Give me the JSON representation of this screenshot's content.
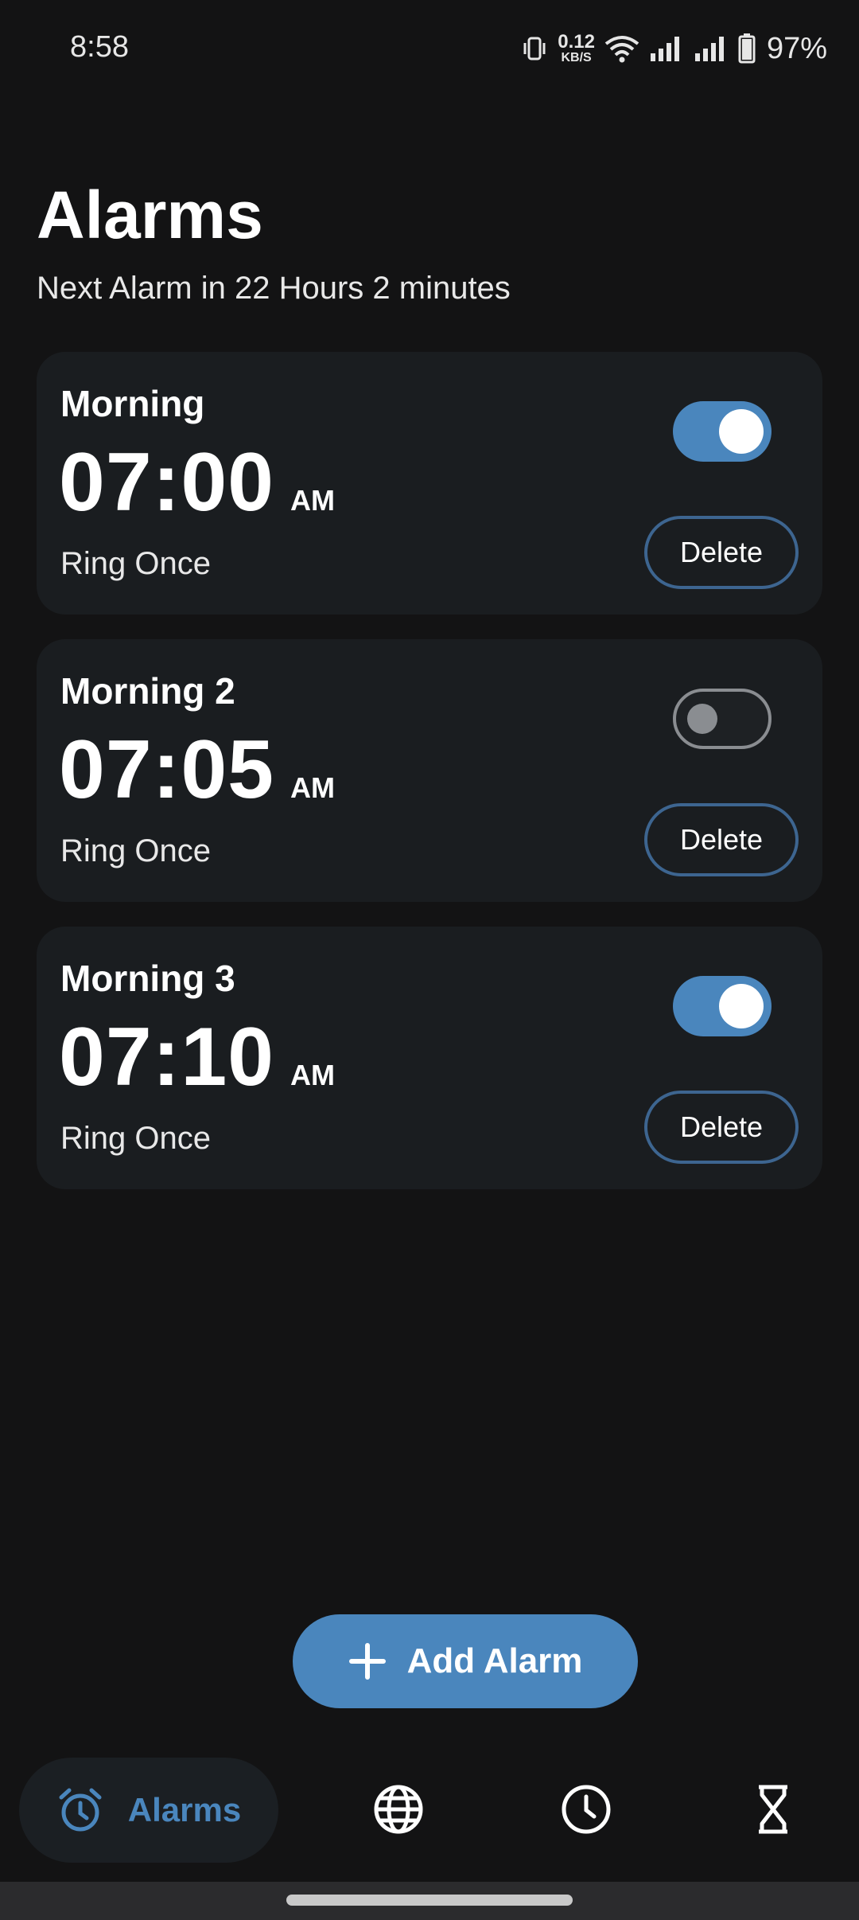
{
  "status_bar": {
    "time": "8:58",
    "net_speed_value": "0.12",
    "net_speed_unit": "KB/S",
    "battery": "97%",
    "icons": [
      "vibrate-icon",
      "wifi-icon",
      "signal-icon",
      "signal-icon",
      "battery-icon"
    ]
  },
  "header": {
    "title": "Alarms",
    "next_alarm": "Next Alarm in 22 Hours 2 minutes"
  },
  "alarms": [
    {
      "name": "Morning",
      "time": "07:00",
      "ampm": "AM",
      "repeat": "Ring Once",
      "enabled": true,
      "delete_label": "Delete"
    },
    {
      "name": "Morning 2",
      "time": "07:05",
      "ampm": "AM",
      "repeat": "Ring Once",
      "enabled": false,
      "delete_label": "Delete"
    },
    {
      "name": "Morning 3",
      "time": "07:10",
      "ampm": "AM",
      "repeat": "Ring Once",
      "enabled": true,
      "delete_label": "Delete"
    }
  ],
  "fab": {
    "label": "Add Alarm",
    "icon": "plus-icon"
  },
  "bottom_nav": {
    "items": [
      {
        "label": "Alarms",
        "icon": "alarm-clock-icon",
        "active": true
      },
      {
        "label": "",
        "icon": "globe-icon",
        "active": false
      },
      {
        "label": "",
        "icon": "clock-icon",
        "active": false
      },
      {
        "label": "",
        "icon": "hourglass-icon",
        "active": false
      }
    ]
  },
  "colors": {
    "background": "#131314",
    "card": "#1a1d20",
    "accent": "#4a86bd",
    "delete_border": "#3d6590",
    "toggle_off": "#8a8d91"
  }
}
